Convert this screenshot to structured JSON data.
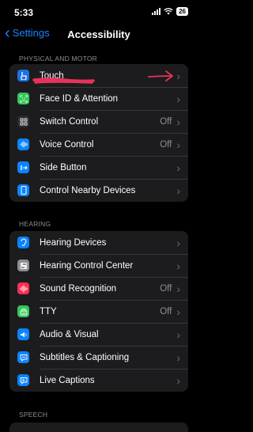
{
  "status_bar": {
    "time": "5:33",
    "battery": "26"
  },
  "nav": {
    "back_label": "Settings",
    "title": "Accessibility"
  },
  "sections": [
    {
      "header": "PHYSICAL AND MOTOR",
      "items": [
        {
          "label": "Touch",
          "value": "",
          "icon": "hand-touch-icon",
          "color": "#1a73e8"
        },
        {
          "label": "Face ID & Attention",
          "value": "",
          "icon": "face-id-icon",
          "color": "#34c759"
        },
        {
          "label": "Switch Control",
          "value": "Off",
          "icon": "switch-control-icon",
          "color": "#2c2c2e"
        },
        {
          "label": "Voice Control",
          "value": "Off",
          "icon": "voice-control-icon",
          "color": "#0a84ff"
        },
        {
          "label": "Side Button",
          "value": "",
          "icon": "side-button-icon",
          "color": "#0a84ff"
        },
        {
          "label": "Control Nearby Devices",
          "value": "",
          "icon": "nearby-devices-icon",
          "color": "#0a84ff"
        }
      ]
    },
    {
      "header": "HEARING",
      "items": [
        {
          "label": "Hearing Devices",
          "value": "",
          "icon": "ear-icon",
          "color": "#0a84ff"
        },
        {
          "label": "Hearing Control Center",
          "value": "",
          "icon": "control-center-icon",
          "color": "#8e8e93"
        },
        {
          "label": "Sound Recognition",
          "value": "Off",
          "icon": "sound-recognition-icon",
          "color": "#ff2d55"
        },
        {
          "label": "TTY",
          "value": "Off",
          "icon": "tty-icon",
          "color": "#34c759"
        },
        {
          "label": "Audio & Visual",
          "value": "",
          "icon": "audio-visual-icon",
          "color": "#0a84ff"
        },
        {
          "label": "Subtitles & Captioning",
          "value": "",
          "icon": "subtitles-icon",
          "color": "#0a84ff"
        },
        {
          "label": "Live Captions",
          "value": "",
          "icon": "live-captions-icon",
          "color": "#0a84ff"
        }
      ]
    },
    {
      "header": "SPEECH"
    }
  ],
  "colors": {
    "accent": "#1a84ff",
    "annotation": "#e8325a"
  }
}
